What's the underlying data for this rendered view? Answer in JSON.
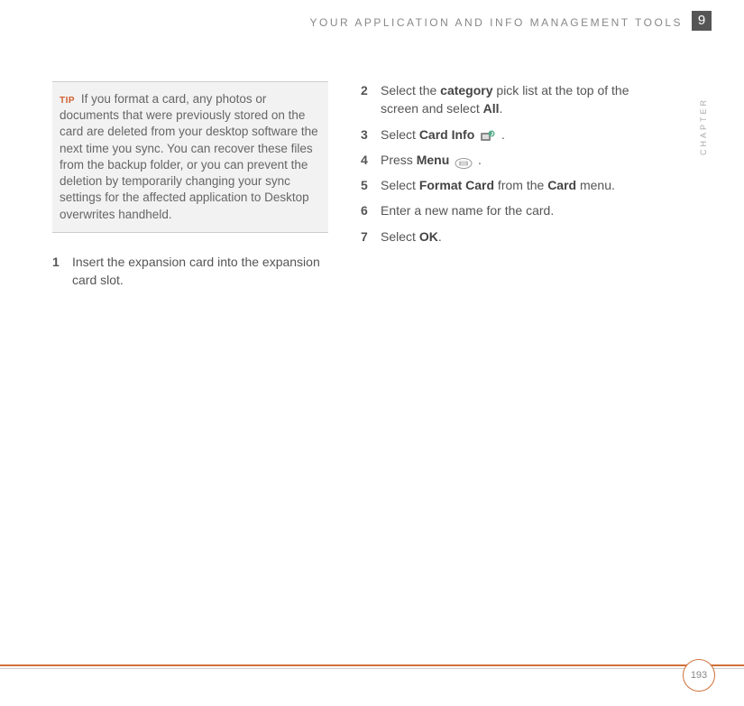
{
  "header": {
    "title": "YOUR APPLICATION AND INFO MANAGEMENT TOOLS",
    "chapter_number": "9",
    "chapter_label": "CHAPTER"
  },
  "tip": {
    "label": "TIP",
    "text": "If you format a card, any photos or documents that were previously stored on the card are deleted from your desktop software the next time you sync. You can recover these files from the backup folder, or you can prevent the deletion by temporarily changing your sync settings for the affected application to Desktop overwrites handheld."
  },
  "steps_left": [
    {
      "num": "1",
      "html": "Insert the expansion card into the expansion card slot."
    }
  ],
  "steps_right": [
    {
      "num": "2",
      "pre": "Select the ",
      "b1": "category",
      "mid": " pick list at the top of the screen and select ",
      "b2": "All",
      "post": "."
    },
    {
      "num": "3",
      "pre": "Select ",
      "b1": "Card Info",
      "icon": "card-info",
      "post": " ."
    },
    {
      "num": "4",
      "pre": "Press ",
      "b1": "Menu",
      "icon": "menu",
      "post": " ."
    },
    {
      "num": "5",
      "pre": "Select ",
      "b1": "Format Card",
      "mid": " from the ",
      "b2": "Card",
      "post": " menu."
    },
    {
      "num": "6",
      "pre": "Enter a new name for the card."
    },
    {
      "num": "7",
      "pre": "Select ",
      "b1": "OK",
      "post": "."
    }
  ],
  "footer": {
    "page": "193"
  }
}
